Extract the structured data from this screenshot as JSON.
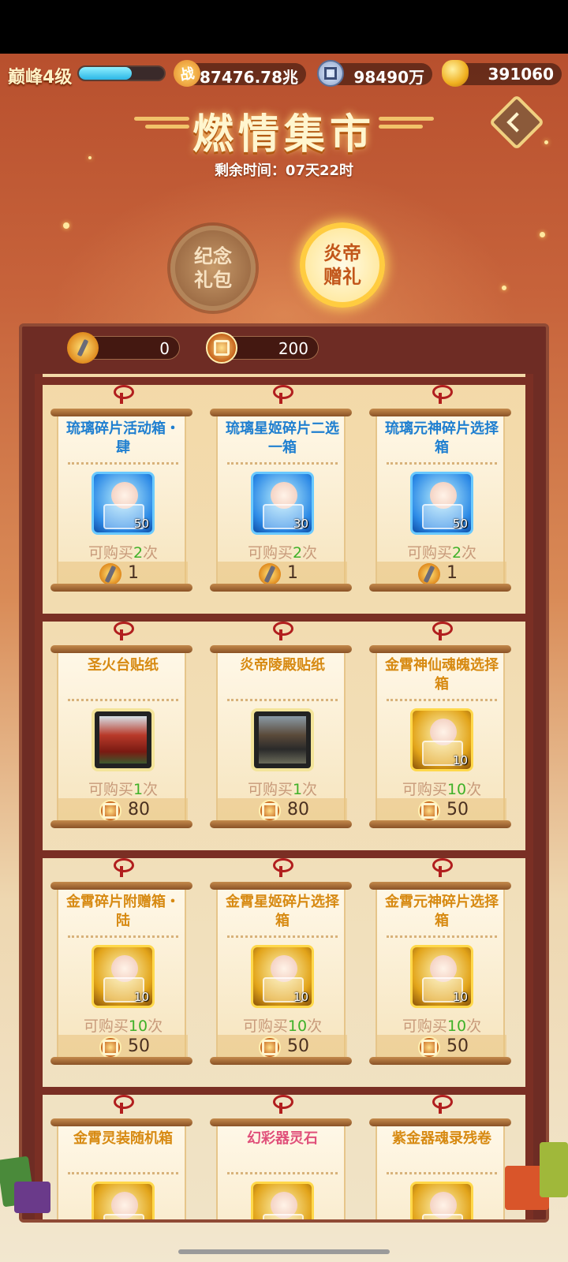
{
  "topbar": {
    "level": "巅峰4级",
    "xp_fraction": 0.62,
    "power_glyph": "战",
    "power": "87476.78兆",
    "silver": "98490万",
    "gold": "391060"
  },
  "header": {
    "title": "燃情集市",
    "remaining_time": "剩余时间：07天22时"
  },
  "tabs": [
    {
      "line1": "纪念",
      "line2": "礼包",
      "active": false
    },
    {
      "line1": "炎帝",
      "line2": "赠礼",
      "active": true
    }
  ],
  "currencies": {
    "torch": "0",
    "medal": "200"
  },
  "items": [
    {
      "name": "琉璃碎片活动箱・肆",
      "qty": "50",
      "limit_prefix": "可购买",
      "limit_n": "2",
      "limit_suffix": "次",
      "price": "1"
    },
    {
      "name": "琉璃星姬碎片二选一箱",
      "qty": "30",
      "limit_prefix": "可购买",
      "limit_n": "2",
      "limit_suffix": "次",
      "price": "1"
    },
    {
      "name": "琉璃元神碎片选择箱",
      "qty": "50",
      "limit_prefix": "可购买",
      "limit_n": "2",
      "limit_suffix": "次",
      "price": "1"
    },
    {
      "name": "圣火台贴纸",
      "qty": "",
      "limit_prefix": "可购买",
      "limit_n": "1",
      "limit_suffix": "次",
      "price": "80"
    },
    {
      "name": "炎帝陵殿贴纸",
      "qty": "",
      "limit_prefix": "可购买",
      "limit_n": "1",
      "limit_suffix": "次",
      "price": "80"
    },
    {
      "name": "金霄神仙魂魄选择箱",
      "qty": "10",
      "limit_prefix": "可购买",
      "limit_n": "10",
      "limit_suffix": "次",
      "price": "50"
    },
    {
      "name": "金霄碎片附赠箱・陆",
      "qty": "10",
      "limit_prefix": "可购买",
      "limit_n": "10",
      "limit_suffix": "次",
      "price": "50"
    },
    {
      "name": "金霄星姬碎片选择箱",
      "qty": "10",
      "limit_prefix": "可购买",
      "limit_n": "10",
      "limit_suffix": "次",
      "price": "50"
    },
    {
      "name": "金霄元神碎片选择箱",
      "qty": "10",
      "limit_prefix": "可购买",
      "limit_n": "10",
      "limit_suffix": "次",
      "price": "50"
    },
    {
      "name": "金霄灵装随机箱"
    },
    {
      "name": "幻彩器灵石"
    },
    {
      "name": "紫金器魂录残卷"
    }
  ],
  "colors": {
    "accent_gold": "#ffcc40",
    "limit_green": "#3fb128",
    "frame_brown": "#7a2f24"
  }
}
